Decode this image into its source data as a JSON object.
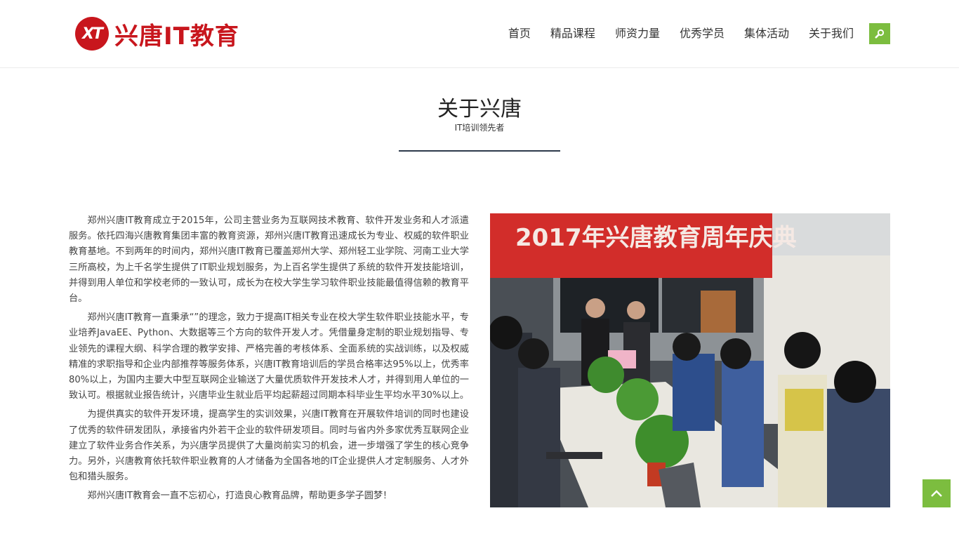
{
  "logo": {
    "mark": "XT",
    "text": "兴唐IT教育"
  },
  "nav": {
    "items": [
      {
        "label": "首页"
      },
      {
        "label": "精品课程"
      },
      {
        "label": "师资力量"
      },
      {
        "label": "优秀学员"
      },
      {
        "label": "集体活动"
      },
      {
        "label": "关于我们"
      }
    ]
  },
  "colors": {
    "brand_red": "#c8161d",
    "accent_green": "#7cbd3f",
    "rule_navy": "#2d3a4b"
  },
  "section": {
    "title": "关于兴唐",
    "subtitle": "IT培训领先者"
  },
  "about": {
    "paragraphs": [
      "郑州兴唐IT教育成立于2015年，公司主营业务为互联网技术教育、软件开发业务和人才派遣服务。依托四海兴唐教育集团丰富的教育资源，郑州兴唐IT教育迅速成长为专业、权威的软件职业教育基地。不到两年的时间内，郑州兴唐IT教育已覆盖郑州大学、郑州轻工业学院、河南工业大学三所高校，为上千名学生提供了IT职业规划服务，为上百名学生提供了系统的软件开发技能培训，并得到用人单位和学校老师的一致认可，成长为在校大学生学习软件职业技能最值得信赖的教育平台。",
      "郑州兴唐IT教育一直秉承“”的理念，致力于提高IT相关专业在校大学生软件职业技能水平，专业培养JavaEE、Python、大数据等三个方向的软件开发人才。凭借量身定制的职业规划指导、专业领先的课程大纲、科学合理的教学安排、严格完善的考核体系、全面系统的实战训练，以及权威精准的求职指导和企业内部推荐等服务体系，兴唐IT教育培训后的学员合格率达95%以上，优秀率80%以上，为国内主要大中型互联网企业输送了大量优质软件开发技术人才，并得到用人单位的一致认可。根据就业报告统计，兴唐毕业生就业后平均起薪超过同期本科毕业生平均水平30%以上。",
      "为提供真实的软件开发环境，提高学生的实训效果，兴唐IT教育在开展软件培训的同时也建设了优秀的软件研发团队，承接省内外若干企业的软件研发项目。同时与省内外多家优秀互联网企业建立了软件业务合作关系，为兴唐学员提供了大量岗前实习的机会，进一步增强了学生的核心竞争力。另外，兴唐教育依托软件职业教育的人才储备为全国各地的IT企业提供人才定制服务、人才外包和猎头服务。",
      "郑州兴唐IT教育会一直不忘初心，打造良心教育品牌，帮助更多学子圆梦！"
    ]
  },
  "photo": {
    "banner_text": "2017年兴唐教育周年庆典"
  }
}
